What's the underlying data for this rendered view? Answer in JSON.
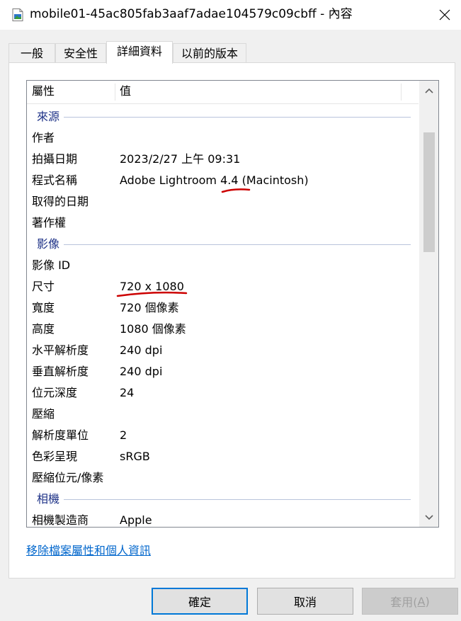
{
  "window": {
    "title": "mobile01-45ac805fab3aaf7adae104579c09cbff - 內容",
    "close_icon": "close-icon"
  },
  "tabs": [
    {
      "label": "一般",
      "active": false
    },
    {
      "label": "安全性",
      "active": false
    },
    {
      "label": "詳細資料",
      "active": true
    },
    {
      "label": "以前的版本",
      "active": false
    }
  ],
  "list": {
    "header": {
      "property": "屬性",
      "value": "值"
    },
    "groups": {
      "source": "來源",
      "image": "影像",
      "camera": "相機"
    },
    "source_rows": [
      {
        "prop": "作者",
        "val": ""
      },
      {
        "prop": "拍攝日期",
        "val": "2023/2/27 上午 09:31"
      },
      {
        "prop": "程式名稱",
        "val": "Adobe Lightroom 4.4 (Macintosh)"
      },
      {
        "prop": "取得的日期",
        "val": ""
      },
      {
        "prop": "著作權",
        "val": ""
      }
    ],
    "image_rows": [
      {
        "prop": "影像 ID",
        "val": ""
      },
      {
        "prop": "尺寸",
        "val": "720 x 1080"
      },
      {
        "prop": "寬度",
        "val": "720 個像素"
      },
      {
        "prop": "高度",
        "val": "1080 個像素"
      },
      {
        "prop": "水平解析度",
        "val": "240 dpi"
      },
      {
        "prop": "垂直解析度",
        "val": "240 dpi"
      },
      {
        "prop": "位元深度",
        "val": "24"
      },
      {
        "prop": "壓縮",
        "val": ""
      },
      {
        "prop": "解析度單位",
        "val": "2"
      },
      {
        "prop": "色彩呈現",
        "val": "sRGB"
      },
      {
        "prop": "壓縮位元/像素",
        "val": ""
      }
    ],
    "camera_rows": [
      {
        "prop": "相機製造商",
        "val": "Apple"
      }
    ]
  },
  "link": {
    "label": "移除檔案屬性和個人資訊"
  },
  "buttons": {
    "ok": "確定",
    "cancel": "取消",
    "apply_prefix": "套用(",
    "apply_key": "A",
    "apply_suffix": ")"
  },
  "colors": {
    "accent": "#0078d7",
    "group_text": "#1e3287",
    "link": "#0066cc",
    "annotation": "#cc0000"
  }
}
